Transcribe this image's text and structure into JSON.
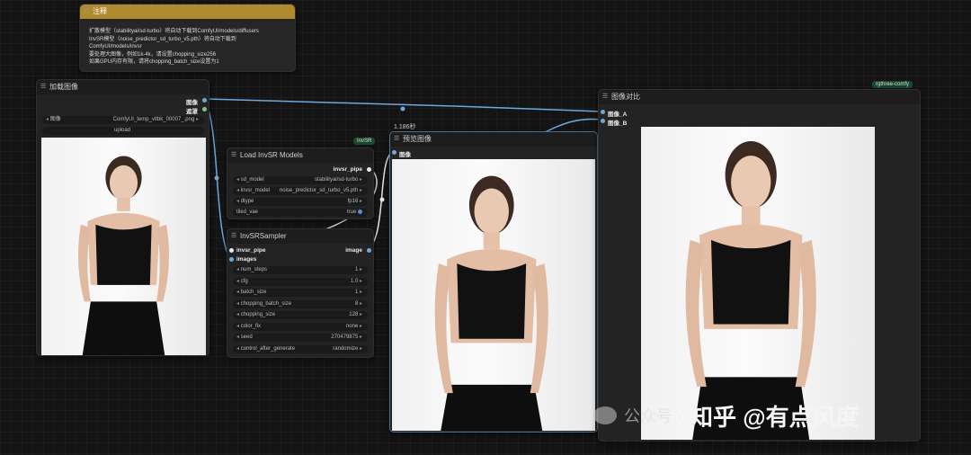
{
  "note": {
    "title": "注释",
    "lines": [
      "扩散模型（stabilityai/sd-turbo）将自动下载到ComfyUI/models/diffusers",
      "InvSR模型（noise_predictor_sd_turbo_v5.pth）将自动下载到",
      "ComfyUI/models/invsr",
      "要处理大图像，例如1k-4k，请设置chopping_size256",
      "如果GPU内存有限，请将chopping_batch_size设置为1"
    ]
  },
  "load_image": {
    "title": "加载图像",
    "out_image": "图像",
    "out_mask": "遮罩",
    "image_label": "图像",
    "image_value": "ComfyUI_temp_vitbk_00007_.png",
    "upload": "upload"
  },
  "invsr_tag": "InvSR",
  "load_models": {
    "title": "Load InvSR Models",
    "out": "invsr_pipe",
    "widgets": [
      {
        "label": "sd_model",
        "value": "stabilityai/sd-turbo"
      },
      {
        "label": "invsr_model",
        "value": "noise_predictor_sd_turbo_v5.pth"
      },
      {
        "label": "dtype",
        "value": "fp16"
      },
      {
        "label": "tiled_vae",
        "value": "true"
      }
    ]
  },
  "sampler": {
    "title": "InvSRSampler",
    "in_pipe": "invsr_pipe",
    "in_images": "images",
    "out": "image",
    "widgets": [
      {
        "label": "num_steps",
        "value": "1"
      },
      {
        "label": "cfg",
        "value": "1.0"
      },
      {
        "label": "batch_size",
        "value": "1"
      },
      {
        "label": "chopping_batch_size",
        "value": "8"
      },
      {
        "label": "chopping_size",
        "value": "128"
      },
      {
        "label": "color_fix",
        "value": "none"
      },
      {
        "label": "seed",
        "value": "270479875"
      },
      {
        "label": "control_after_generate",
        "value": "randomize"
      }
    ]
  },
  "preview": {
    "time": "1.186秒",
    "title": "预览图像",
    "in_image": "图像"
  },
  "compare": {
    "tag": "rgthree-comfy",
    "title": "图像对比",
    "in_a": "图像_A",
    "in_b": "图像_B"
  },
  "watermark": {
    "brand": "知乎 @有点风度",
    "wechat": "公众号 · "
  }
}
